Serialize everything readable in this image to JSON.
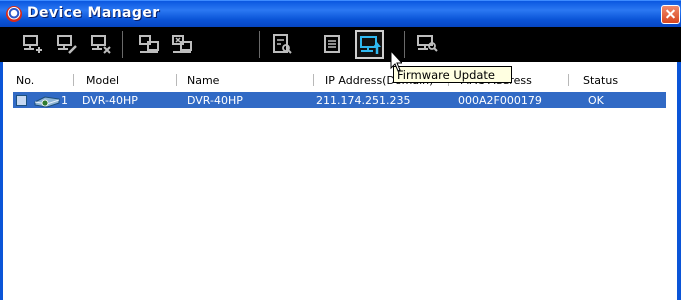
{
  "window": {
    "title": "Device Manager"
  },
  "toolbar": {
    "buttons": [
      {
        "name": "add-device",
        "icon": "monitor-plus-icon"
      },
      {
        "name": "edit-device",
        "icon": "monitor-pencil-icon"
      },
      {
        "name": "delete-device",
        "icon": "monitor-x-icon"
      },
      {
        "name": "connect",
        "icon": "monitors-connect-icon"
      },
      {
        "name": "disconnect",
        "icon": "monitors-disconnect-icon"
      },
      {
        "name": "check-list",
        "icon": "checklist-search-icon"
      },
      {
        "name": "properties",
        "icon": "document-lines-icon"
      },
      {
        "name": "firmware-update",
        "icon": "monitor-up-arrow-icon",
        "active": true
      },
      {
        "name": "search-device",
        "icon": "monitor-magnifier-icon"
      }
    ],
    "tooltip": "Firmware Update"
  },
  "list": {
    "columns": [
      "No.",
      "Model",
      "Name",
      "IP Address(Domain)",
      "MAC Address",
      "Status"
    ],
    "rows": [
      {
        "no": "1",
        "model": "DVR-40HP",
        "name": "DVR-40HP",
        "ip": "211.174.251.235",
        "mac": "000A2F000179",
        "status": "OK",
        "selected": true
      }
    ]
  },
  "colors": {
    "titlebar": "#0b55d8",
    "selection": "#316ac5",
    "toolbar": "#000000",
    "tooltip": "#ffffe1",
    "close": "#d8451f"
  }
}
